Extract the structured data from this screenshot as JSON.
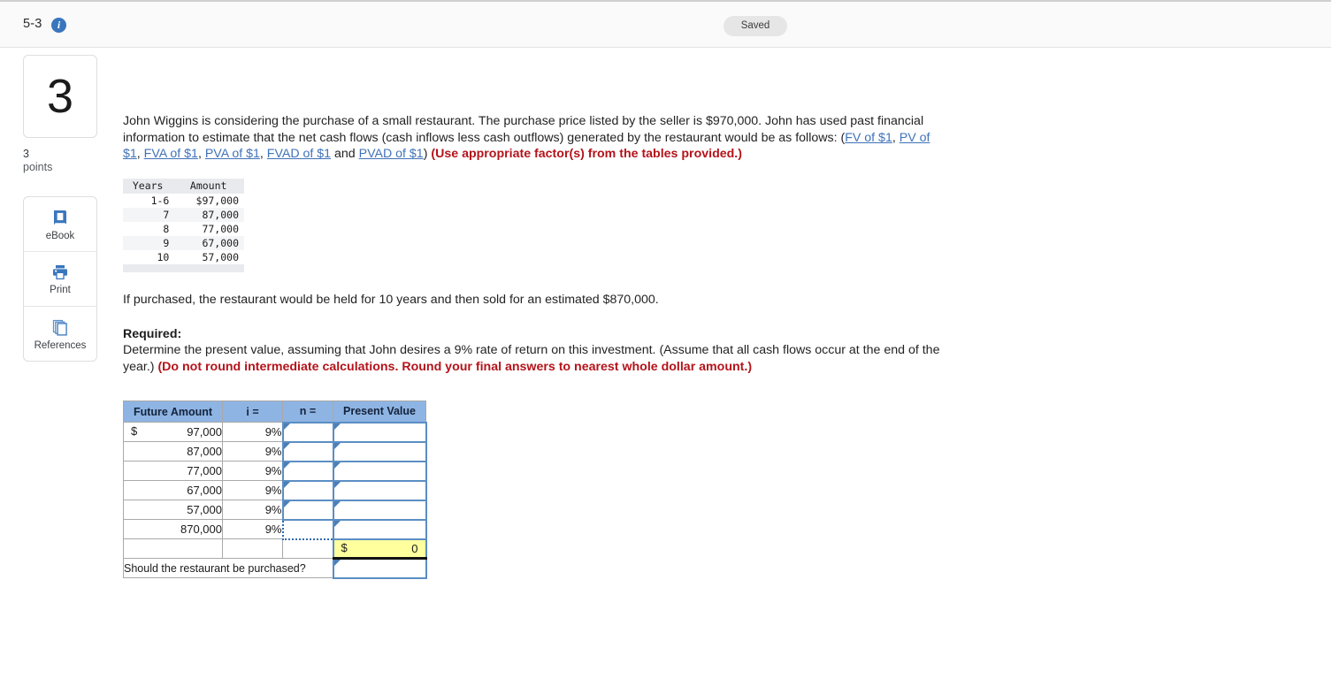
{
  "header": {
    "question_number": "5-3",
    "info_icon": "info-icon",
    "saved_label": "Saved"
  },
  "rail": {
    "question_badge": "3",
    "points_value": "3",
    "points_label": "points",
    "tools": [
      {
        "icon": "ebook-icon",
        "label": "eBook"
      },
      {
        "icon": "printer-icon",
        "label": "Print"
      },
      {
        "icon": "references-icon",
        "label": "References"
      }
    ]
  },
  "prompt": {
    "part1": "John Wiggins is considering the purchase of a small restaurant. The purchase price listed by the seller is $970,000. John has used past financial information to estimate that the net cash flows (cash inflows less cash outflows) generated by the restaurant would be as follows: (",
    "links": [
      "FV of $1",
      "PV of $1",
      "FVA of $1",
      "PVA of $1",
      "FVAD of $1",
      "PVAD of $1"
    ],
    "link_sep": ", ",
    "link_last_sep": " and ",
    "after_links": ") ",
    "bold_note": "(Use appropriate factor(s) from the tables provided.)"
  },
  "data_table": {
    "columns": [
      "Years",
      "Amount"
    ],
    "rows": [
      {
        "years": "1-6",
        "amount": "$97,000"
      },
      {
        "years": "7",
        "amount": "87,000"
      },
      {
        "years": "8",
        "amount": "77,000"
      },
      {
        "years": "9",
        "amount": "67,000"
      },
      {
        "years": "10",
        "amount": "57,000"
      }
    ]
  },
  "held_text": "If purchased, the restaurant would be held for 10 years and then sold for an estimated $870,000.",
  "required": {
    "heading": "Required:",
    "body": "Determine the present value, assuming that John desires a 9% rate of return on this investment. (Assume that all cash flows occur at the end of the year.) ",
    "bold_note": "(Do not round intermediate calculations. Round your final answers to nearest whole dollar amount.)"
  },
  "answer_table": {
    "headers": [
      "Future Amount",
      "i =",
      "n =",
      "Present Value"
    ],
    "rows": [
      {
        "dollar": "$",
        "amount": "97,000",
        "rate": "9%",
        "n": "",
        "pv": ""
      },
      {
        "dollar": "",
        "amount": "87,000",
        "rate": "9%",
        "n": "",
        "pv": ""
      },
      {
        "dollar": "",
        "amount": "77,000",
        "rate": "9%",
        "n": "",
        "pv": ""
      },
      {
        "dollar": "",
        "amount": "67,000",
        "rate": "9%",
        "n": "",
        "pv": ""
      },
      {
        "dollar": "",
        "amount": "57,000",
        "rate": "9%",
        "n": "",
        "pv": ""
      },
      {
        "dollar": "",
        "amount": "870,000",
        "rate": "9%",
        "n": "",
        "pv": "",
        "n_focused": true
      }
    ],
    "total": {
      "dollar": "$",
      "value": "0"
    },
    "question_label": "Should the restaurant be purchased?",
    "question_answer": ""
  },
  "colors": {
    "header_blue": "#8eb4e3",
    "input_border": "#5b8ec4",
    "total_yellow": "#ffff9e",
    "link": "#3f72b8",
    "red_note": "#b4131a",
    "info_badge": "#3a76bd"
  }
}
